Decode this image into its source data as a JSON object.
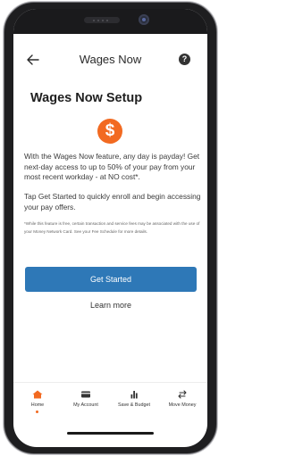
{
  "header": {
    "title": "Wages Now",
    "back_icon": "arrow-left-icon",
    "help_icon": "help-circle-icon",
    "help_glyph": "?"
  },
  "main": {
    "title": "Wages Now Setup",
    "dollar_glyph": "$",
    "accent_color": "#f26a21",
    "paragraph1": "With the Wages Now feature, any day is payday! Get next-day access to up to 50% of your pay from your most recent workday - at NO cost*.",
    "paragraph2": "Tap Get Started to quickly enroll and begin accessing your pay offers.",
    "disclaimer": "*While this feature is free, certain transaction and service fees may be associated with the use of your Money Network Card. See your Fee Schedule for more details.",
    "primary_button": "Get Started",
    "primary_color": "#2e78b7",
    "secondary_link": "Learn more"
  },
  "tabbar": {
    "tabs": [
      {
        "label": "Home",
        "icon": "home-icon",
        "active": true
      },
      {
        "label": "My Account",
        "icon": "card-icon",
        "active": false
      },
      {
        "label": "Save & Budget",
        "icon": "bar-chart-icon",
        "active": false
      },
      {
        "label": "Move Money",
        "icon": "transfer-arrows-icon",
        "active": false
      }
    ]
  }
}
